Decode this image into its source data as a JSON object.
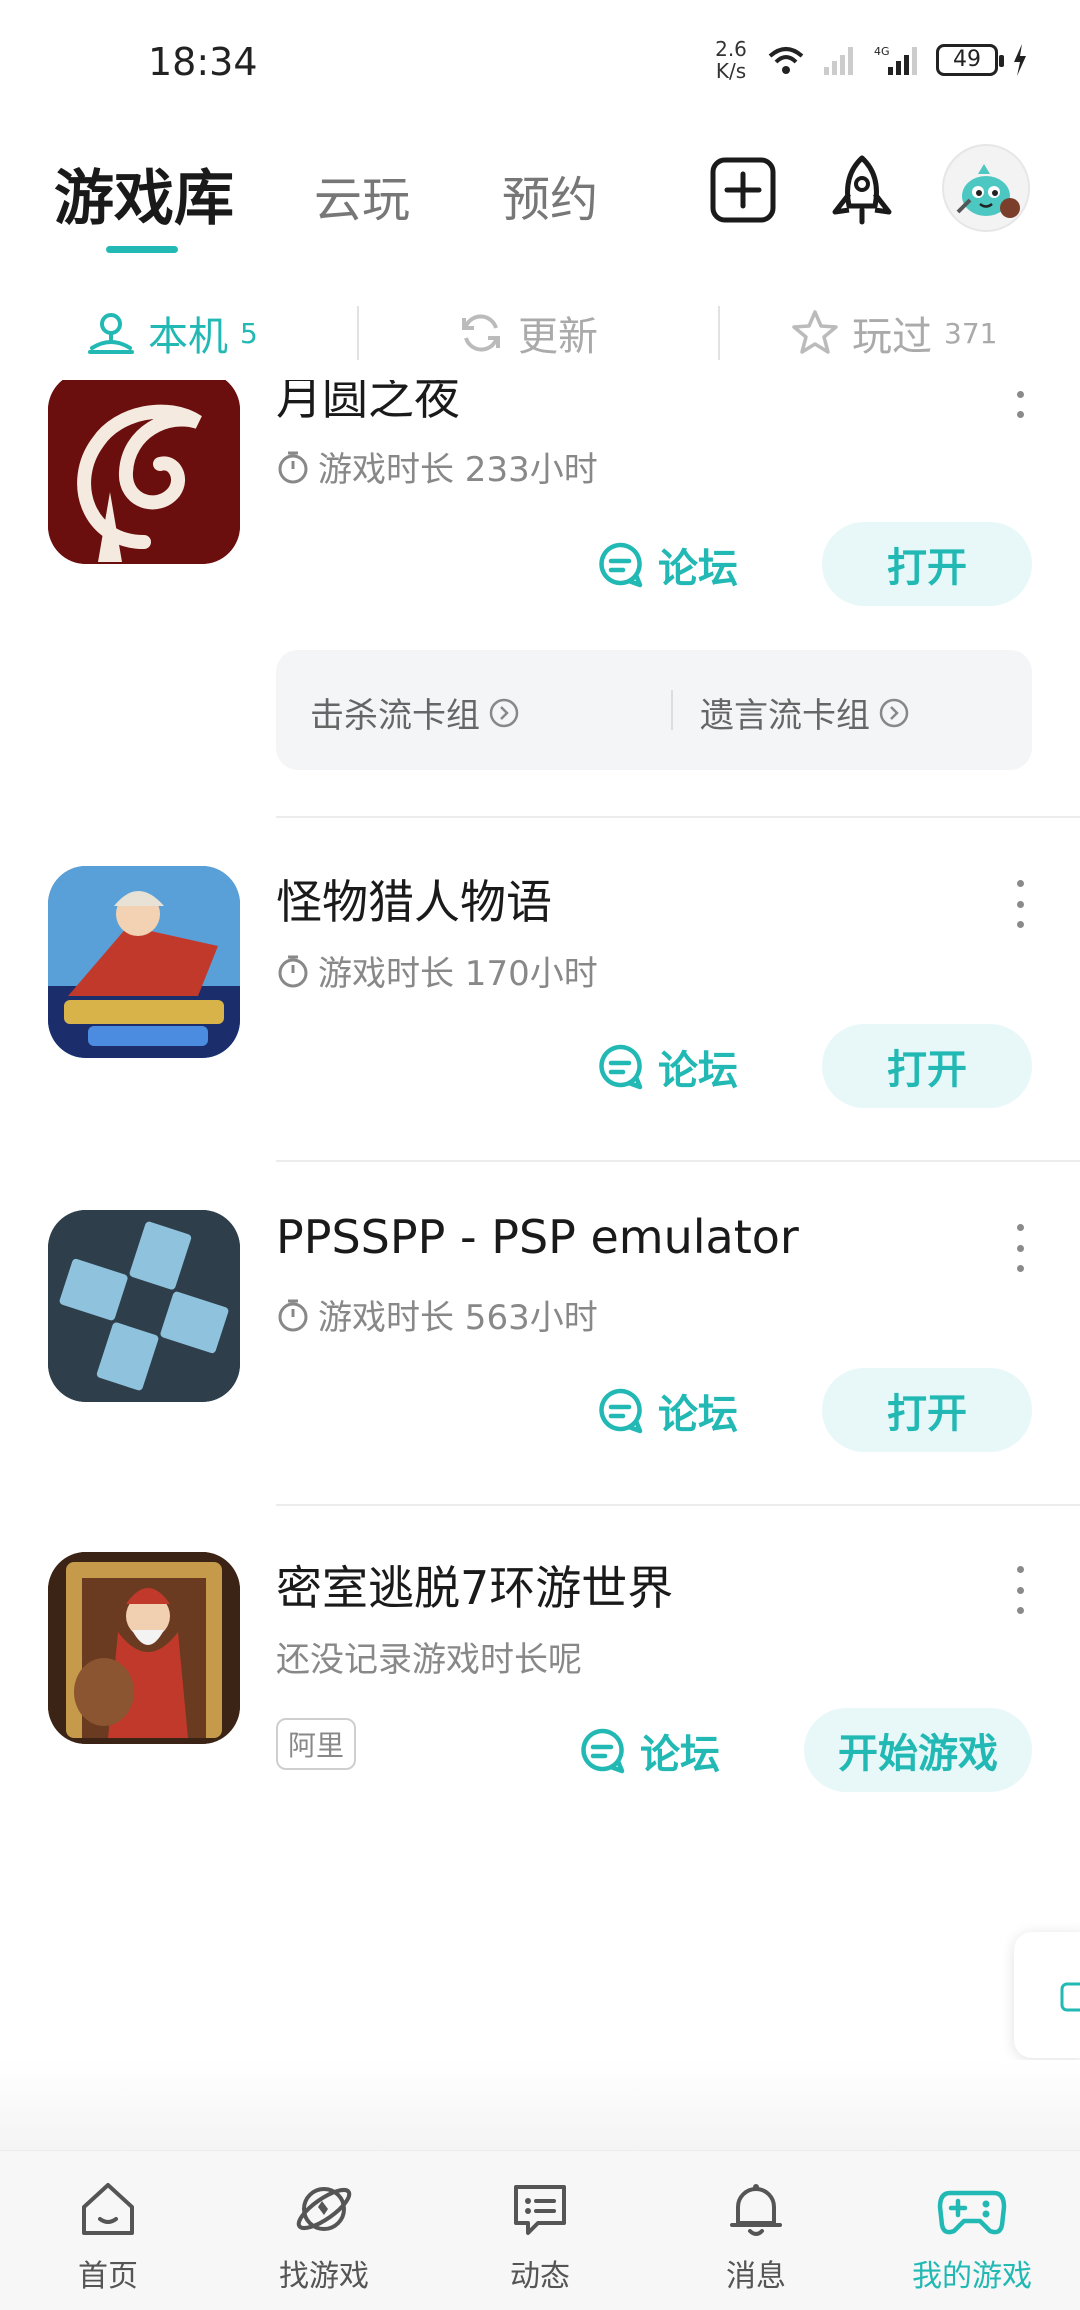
{
  "status_bar": {
    "time": "18:34",
    "net_speed_value": "2.6",
    "net_speed_unit": "K/s",
    "battery": "49"
  },
  "header": {
    "tabs": [
      {
        "label": "游戏库",
        "active": true
      },
      {
        "label": "云玩",
        "active": false
      },
      {
        "label": "预约",
        "active": false
      }
    ],
    "icons": [
      "add-square-icon",
      "rocket-icon",
      "avatar"
    ]
  },
  "filters": {
    "local": {
      "label": "本机",
      "count": "5"
    },
    "update": {
      "label": "更新"
    },
    "played": {
      "label": "玩过",
      "count": "371"
    }
  },
  "games": [
    {
      "title": "月圆之夜",
      "playtime": "游戏时长 233小时",
      "forum_label": "论坛",
      "action_label": "打开",
      "deck_links": [
        "击杀流卡组",
        "遗言流卡组"
      ]
    },
    {
      "title": "怪物猎人物语",
      "playtime": "游戏时长 170小时",
      "forum_label": "论坛",
      "action_label": "打开"
    },
    {
      "title": "PPSSPP - PSP emulator",
      "playtime": "游戏时长 563小时",
      "forum_label": "论坛",
      "action_label": "打开"
    },
    {
      "title": "密室逃脱7环游世界",
      "playtime": "还没记录游戏时长呢",
      "tag": "阿里",
      "forum_label": "论坛",
      "action_label": "开始游戏"
    }
  ],
  "bottom_nav": [
    {
      "label": "首页",
      "icon": "home-icon",
      "active": false
    },
    {
      "label": "找游戏",
      "icon": "planet-icon",
      "active": false
    },
    {
      "label": "动态",
      "icon": "feed-icon",
      "active": false
    },
    {
      "label": "消息",
      "icon": "bell-icon",
      "active": false
    },
    {
      "label": "我的游戏",
      "icon": "gamepad-icon",
      "active": true
    }
  ],
  "colors": {
    "accent": "#22b9b4",
    "button_bg": "#e8f8f8",
    "text_primary": "#1a1a1a",
    "text_secondary": "#888888"
  }
}
